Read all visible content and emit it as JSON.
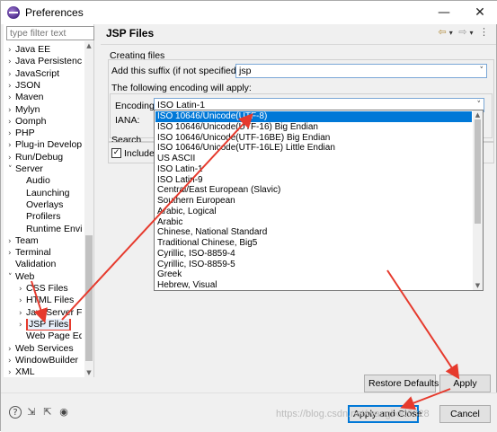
{
  "window": {
    "title": "Preferences",
    "controls": {
      "minimize": "—",
      "maximize": "☐",
      "close": "✕"
    }
  },
  "sidebar": {
    "filter_placeholder": "type filter text",
    "items": [
      {
        "label": "Java EE",
        "indent": 0,
        "arrow": "›"
      },
      {
        "label": "Java Persistence",
        "indent": 0,
        "arrow": "›"
      },
      {
        "label": "JavaScript",
        "indent": 0,
        "arrow": "›"
      },
      {
        "label": "JSON",
        "indent": 0,
        "arrow": "›"
      },
      {
        "label": "Maven",
        "indent": 0,
        "arrow": "›"
      },
      {
        "label": "Mylyn",
        "indent": 0,
        "arrow": "›"
      },
      {
        "label": "Oomph",
        "indent": 0,
        "arrow": "›"
      },
      {
        "label": "PHP",
        "indent": 0,
        "arrow": "›"
      },
      {
        "label": "Plug-in Developm",
        "indent": 0,
        "arrow": "›"
      },
      {
        "label": "Run/Debug",
        "indent": 0,
        "arrow": "›"
      },
      {
        "label": "Server",
        "indent": 0,
        "arrow": "˅"
      },
      {
        "label": "Audio",
        "indent": 1,
        "arrow": ""
      },
      {
        "label": "Launching",
        "indent": 1,
        "arrow": ""
      },
      {
        "label": "Overlays",
        "indent": 1,
        "arrow": ""
      },
      {
        "label": "Profilers",
        "indent": 1,
        "arrow": ""
      },
      {
        "label": "Runtime Envir",
        "indent": 1,
        "arrow": ""
      },
      {
        "label": "Team",
        "indent": 0,
        "arrow": "›"
      },
      {
        "label": "Terminal",
        "indent": 0,
        "arrow": "›"
      },
      {
        "label": "Validation",
        "indent": 0,
        "arrow": ""
      },
      {
        "label": "Web",
        "indent": 0,
        "arrow": "˅"
      },
      {
        "label": "CSS Files",
        "indent": 1,
        "arrow": "›"
      },
      {
        "label": "HTML Files",
        "indent": 1,
        "arrow": "›"
      },
      {
        "label": "JavaServer Fac",
        "indent": 1,
        "arrow": "›"
      },
      {
        "label": "JSP Files",
        "indent": 1,
        "arrow": "›",
        "selected": true
      },
      {
        "label": "Web Page Edi",
        "indent": 1,
        "arrow": ""
      },
      {
        "label": "Web Services",
        "indent": 0,
        "arrow": "›"
      },
      {
        "label": "WindowBuilder",
        "indent": 0,
        "arrow": "›"
      },
      {
        "label": "XML",
        "indent": 0,
        "arrow": "›"
      }
    ]
  },
  "page": {
    "title": "JSP Files",
    "creating_files_label": "Creating files",
    "suffix_label": "Add this suffix (if not specified):",
    "suffix_value": "jsp",
    "encoding_info": "The following encoding will apply:",
    "encoding_label": "Encoding:",
    "encoding_value": "ISO Latin-1",
    "iana_label": "IANA:",
    "search_label": "Search",
    "include_label": "Include"
  },
  "encoding_options": [
    "ISO 10646/Unicode(UTF-8)",
    "ISO 10646/Unicode(UTF-16) Big Endian",
    "ISO 10646/Unicode(UTF-16BE) Big Endian",
    "ISO 10646/Unicode(UTF-16LE) Little Endian",
    "US ASCII",
    "ISO Latin-1",
    "ISO Latin-9",
    "Central/East European (Slavic)",
    "Southern European",
    "Arabic, Logical",
    "Arabic",
    "Chinese, National Standard",
    "Traditional Chinese, Big5",
    "Cyrillic, ISO-8859-4",
    "Cyrillic, ISO-8859-5",
    "Greek",
    "Hebrew, Visual"
  ],
  "buttons": {
    "restore_defaults": "Restore Defaults",
    "apply": "Apply",
    "apply_and_close": "Apply and Close",
    "cancel": "Cancel"
  },
  "watermark": "https://blog.csdn.net/wangbo00328",
  "colors": {
    "selection": "#0078d7",
    "annotation_red": "#e63a2d"
  }
}
